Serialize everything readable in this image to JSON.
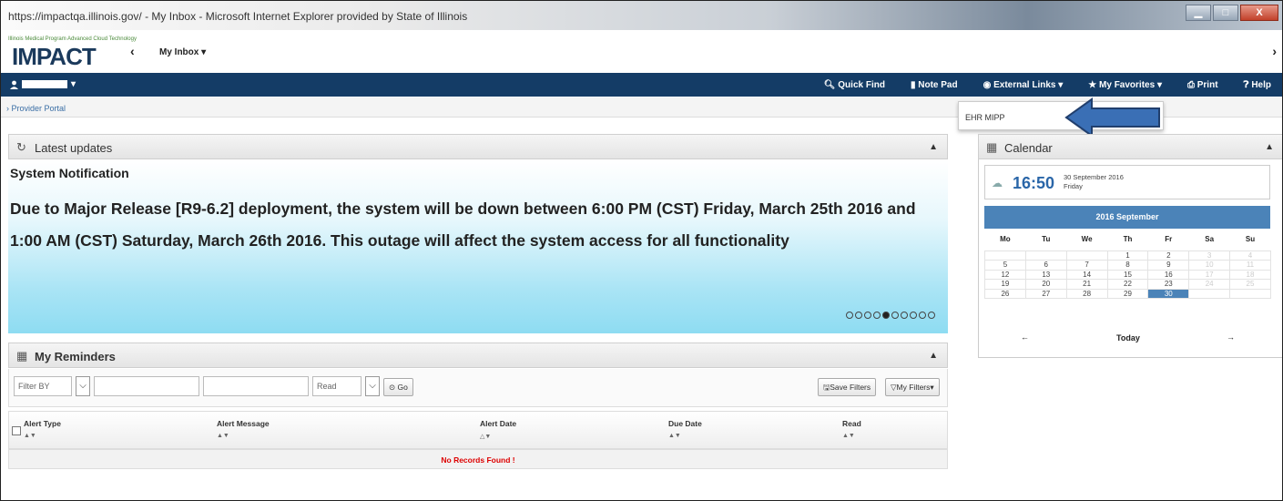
{
  "window": {
    "title": "https://impactqa.illinois.gov/ - My Inbox - Microsoft Internet Explorer provided by State of Illinois",
    "minimize": "▁",
    "maximize": "□",
    "close": "X"
  },
  "brand": {
    "logo_tag": "Illinois Medical Program Advanced Cloud Technology",
    "logo_word": "IMPACT",
    "back": "‹",
    "inbox_menu": "My Inbox ▾",
    "forward": "›"
  },
  "nav": {
    "user_caret": "▾",
    "items": [
      {
        "icon": "search-icon",
        "glyph": "🔍",
        "label": "Quick Find"
      },
      {
        "icon": "notepad-icon",
        "glyph": "▮",
        "label": "Note Pad"
      },
      {
        "icon": "globe-icon",
        "glyph": "◉",
        "label": "External Links ▾"
      },
      {
        "icon": "star-icon",
        "glyph": "★",
        "label": "My Favorites ▾"
      },
      {
        "icon": "print-icon",
        "glyph": "⎙",
        "label": "Print"
      },
      {
        "icon": "help-icon",
        "glyph": "❓",
        "label": "Help"
      }
    ]
  },
  "breadcrumb": {
    "sep": "›",
    "label": "Provider Portal"
  },
  "dropdown": {
    "item": "EHR MIPP"
  },
  "updates": {
    "refresh_glyph": "↻",
    "title": "Latest updates",
    "caret": "▲",
    "heading": "System Notification",
    "message": "Due to Major Release [R9-6.2] deployment, the system will be down between 6:00 PM (CST) Friday, March 25th 2016 and 1:00 AM (CST) Saturday, March 26th 2016. This outage will affect the system access for all functionality",
    "slide_count": 10,
    "active_slide": 5
  },
  "reminders": {
    "grid_glyph": "▦",
    "title": "My Reminders",
    "caret": "▲",
    "filter_by": "Filter BY",
    "read_value": "Read",
    "go": "⊙ Go",
    "save_filters": "Save Filters",
    "my_filters": "My Filters▾",
    "columns": [
      {
        "label": "Alert Type",
        "sort": "▲▼"
      },
      {
        "label": "Alert Message",
        "sort": "▲▼"
      },
      {
        "label": "Alert Date",
        "sort": "△▼"
      },
      {
        "label": "Due Date",
        "sort": "▲▼"
      },
      {
        "label": "Read",
        "sort": "▲▼"
      }
    ],
    "empty": "No Records Found !"
  },
  "calendar": {
    "grid_glyph": "▦",
    "title": "Calendar",
    "caret": "▲",
    "time": "16:50",
    "date": "30 September 2016",
    "weekday": "Friday",
    "month": "2016 September",
    "weekdays": [
      "Mo",
      "Tu",
      "We",
      "Th",
      "Fr",
      "Sa",
      "Su"
    ],
    "weeks": [
      [
        "",
        "",
        "",
        "1",
        "2",
        "3",
        "4"
      ],
      [
        "5",
        "6",
        "7",
        "8",
        "9",
        "10",
        "11"
      ],
      [
        "12",
        "13",
        "14",
        "15",
        "16",
        "17",
        "18"
      ],
      [
        "19",
        "20",
        "21",
        "22",
        "23",
        "24",
        "25"
      ],
      [
        "26",
        "27",
        "28",
        "29",
        "30",
        "",
        ""
      ]
    ],
    "selected": "30",
    "prev": "←",
    "today": "Today",
    "next": "→"
  },
  "colors": {
    "navbar": "#143c66",
    "accent": "#4b83b8",
    "arrow": "#3a6fb5"
  }
}
